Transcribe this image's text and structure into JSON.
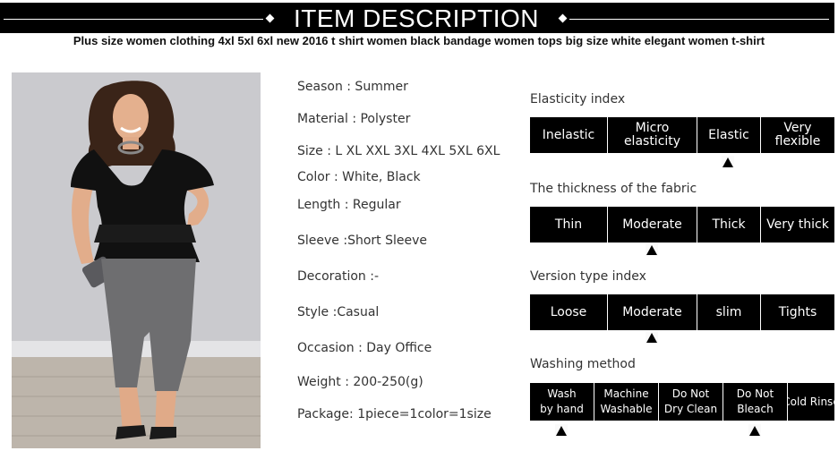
{
  "header": {
    "title": "ITEM DESCRIPTION",
    "product_title": "Plus size women clothing 4xl 5xl 6xl new 2016 t shirt women black bandage women tops big size white elegant women t-shirt"
  },
  "specs": [
    "Season : Summer",
    "Material : Polyster",
    "Size : L XL XXL 3XL 4XL 5XL 6XL",
    "Color : White, Black",
    "Length : Regular",
    "Sleeve :Short Sleeve",
    "Decoration :-",
    "Style :Casual",
    "Occasion : Day Office",
    "Weight : 200-250(g)",
    "Package: 1piece=1color=1size"
  ],
  "indices": [
    {
      "title": "Elasticity index",
      "options": [
        "Inelastic",
        "Micro\nelasticity",
        "Elastic",
        "Very\nflexible"
      ],
      "selected": [
        2
      ]
    },
    {
      "title": "The thickness of the fabric",
      "options": [
        "Thin",
        "Moderate",
        "Thick",
        "Very thick"
      ],
      "selected": [
        1
      ]
    },
    {
      "title": "Version type index",
      "options": [
        "Loose",
        "Moderate",
        "slim",
        "Tights"
      ],
      "selected": [
        1
      ]
    },
    {
      "title": "Washing method",
      "options": [
        "Wash\nby hand",
        "Machine\nWashable",
        "Do Not\nDry Clean",
        "Do Not\nBleach",
        "Cold Rinse"
      ],
      "selected": [
        0,
        3
      ]
    }
  ],
  "colors": {
    "header_bg": "#000000",
    "cell_bg": "#000000",
    "cell_text": "#ffffff",
    "top_black": "#111111",
    "pants_gray": "#6e6e70"
  }
}
